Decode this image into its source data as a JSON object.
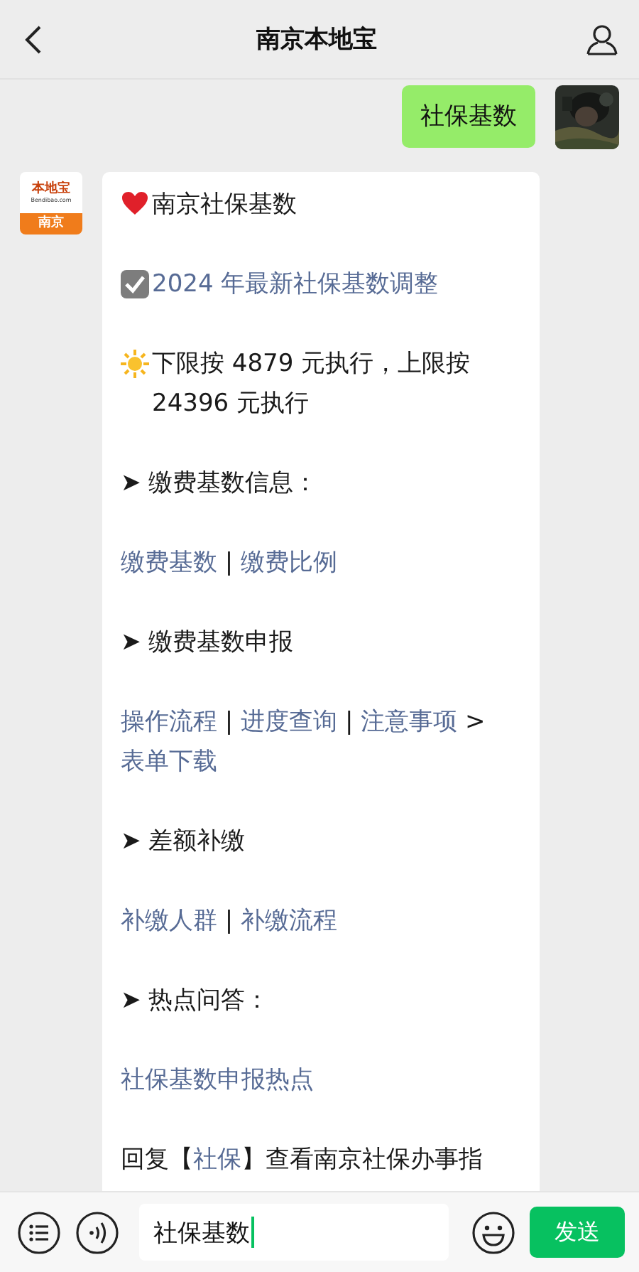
{
  "header": {
    "title": "南京本地宝"
  },
  "messages": [
    {
      "kind": "sent",
      "text": "社保基数"
    },
    {
      "kind": "received",
      "logo": {
        "name": "本地宝",
        "site": "Bendibao.com",
        "city": "南京"
      },
      "paragraphs": [
        {
          "kind": "heart",
          "segments": [
            {
              "text": "南京社保基数",
              "link": false
            }
          ]
        },
        {
          "kind": "check",
          "segments": [
            {
              "text": "2024 年最新社保基数调整",
              "link": true
            }
          ]
        },
        {
          "kind": "sun",
          "segments": [
            {
              "text": "下限按 4879 元执行，上限按 24396 元执行",
              "link": false
            }
          ]
        },
        {
          "kind": "plain",
          "segments": [
            {
              "text": "➤ 缴费基数信息：",
              "link": false
            }
          ]
        },
        {
          "kind": "plain",
          "segments": [
            {
              "text": "缴费基数",
              "link": true
            },
            {
              "text": " | ",
              "link": false
            },
            {
              "text": "缴费比例",
              "link": true
            }
          ]
        },
        {
          "kind": "plain",
          "segments": [
            {
              "text": "➤ 缴费基数申报",
              "link": false
            }
          ]
        },
        {
          "kind": "plain",
          "segments": [
            {
              "text": "操作流程",
              "link": true
            },
            {
              "text": " | ",
              "link": false
            },
            {
              "text": "进度查询",
              "link": true
            },
            {
              "text": " | ",
              "link": false
            },
            {
              "text": "注意事项",
              "link": true
            },
            {
              "text": " > ",
              "link": false
            },
            {
              "text": "表单下载",
              "link": true
            }
          ]
        },
        {
          "kind": "plain",
          "segments": [
            {
              "text": "➤ 差额补缴",
              "link": false
            }
          ]
        },
        {
          "kind": "plain",
          "segments": [
            {
              "text": "补缴人群",
              "link": true
            },
            {
              "text": " | ",
              "link": false
            },
            {
              "text": "补缴流程",
              "link": true
            }
          ]
        },
        {
          "kind": "plain",
          "segments": [
            {
              "text": "➤ 热点问答：",
              "link": false
            }
          ]
        },
        {
          "kind": "plain",
          "segments": [
            {
              "text": "社保基数申报热点",
              "link": true
            }
          ]
        },
        {
          "kind": "plain",
          "segments": [
            {
              "text": "回复【",
              "link": false
            },
            {
              "text": "社保",
              "link": true
            },
            {
              "text": "】查看南京社保办事指",
              "link": false
            }
          ]
        }
      ]
    }
  ],
  "input_bar": {
    "value": "社保基数",
    "send": "发送"
  }
}
